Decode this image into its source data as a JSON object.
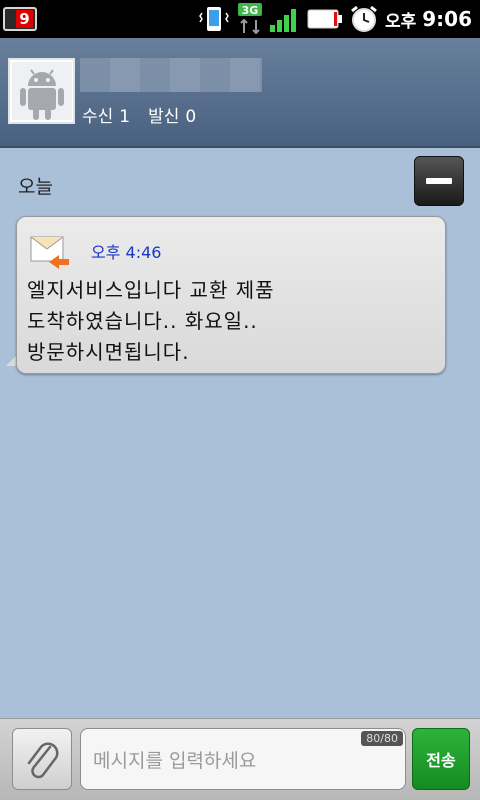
{
  "status_bar": {
    "notification_count": "9",
    "icons": [
      "vibrate-phone-icon",
      "3g-data-icon",
      "signal-strength-icon",
      "battery-icon",
      "alarm-clock-icon"
    ],
    "network_label": "3G",
    "ampm": "오후",
    "time": "9:06"
  },
  "contact": {
    "avatar_icon": "android-avatar-icon",
    "received_label": "수신",
    "received_count": "1",
    "sent_label": "발신",
    "sent_count": "0"
  },
  "conversation": {
    "date_label": "오늘",
    "collapse_icon": "minus-icon",
    "messages": [
      {
        "icon": "incoming-mail-icon",
        "time": "오후 4:46",
        "text": "엘지서비스입니다 교환 제품\n도착하였습니다.. 화요일..\n방문하시면됩니다."
      }
    ]
  },
  "compose": {
    "attach_icon": "paperclip-icon",
    "placeholder": "메시지를 입력하세요",
    "char_count": "80/80",
    "send_label": "전송"
  },
  "colors": {
    "background": "#a9c0d8",
    "header": "#566d8a",
    "send_button": "#1f9f2d",
    "message_time": "#1a36c8"
  }
}
